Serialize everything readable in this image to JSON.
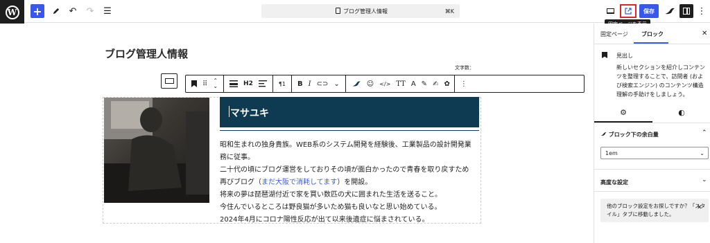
{
  "topbar": {
    "logo_letter": "W",
    "add_icon": "+",
    "pen_icon": "pen-icon",
    "undo_icon": "↶",
    "redo_icon": "↷",
    "list_icon": "☰",
    "command_title": "ブログ管理人情報",
    "command_shortcut": "⌘K",
    "save_label": "保存",
    "more_icon": "⋮",
    "tooltip": "固定ページを表示"
  },
  "editor": {
    "post_title": "ブログ管理人情報",
    "word_count": "文字数：",
    "heading_text": "マサユキ",
    "paragraphs": [
      "昭和生まれの独身貴族。WEB系のシステム開発を経験後、工業製品の設計開発業",
      "務に従事。",
      "二十代の頃にブログ運営をしておりその頃が面白かったので青春を取り戻すため",
      "将来の夢は琵琶湖付近で家を買い数匹の犬に囲まれた生活を送ること。",
      "今住んでいるところは野良猫が多いため猫も良いなと思い始めている。",
      "2024年4月にコロナ陽性反応が出て以来後遺症に悩まされている。"
    ],
    "link_line_before": "再びブログ（",
    "link_text": "まだ大阪で消耗してます",
    "link_line_after": "）を開設。",
    "toolbar": {
      "heading_level": "H2",
      "text_level": "1",
      "bold": "B",
      "italic": "I",
      "code": "</>",
      "font_size": "TT",
      "font": "A",
      "more": "⋮"
    }
  },
  "sidebar": {
    "tab_page": "固定ページ",
    "tab_block": "ブロック",
    "close": "✕",
    "block_name": "見出し",
    "block_description": "新しいセクションを紹介しコンテンツを整理することで、訪問者 (および検索エンジン) のコンテンツ構造理解の手助けをしましょう。",
    "panel_spacing_title": "ブロック下の余白量",
    "spacing_value": "1em",
    "panel_advanced_title": "高度な設定",
    "notice_text": "他のブロック設定をお探しですか？「スタイル」タブに移動しました。",
    "notice_close": "✕"
  },
  "colors": {
    "accent": "#3858e9",
    "heading_bg": "#0e3a52",
    "highlight": "#e02424"
  }
}
